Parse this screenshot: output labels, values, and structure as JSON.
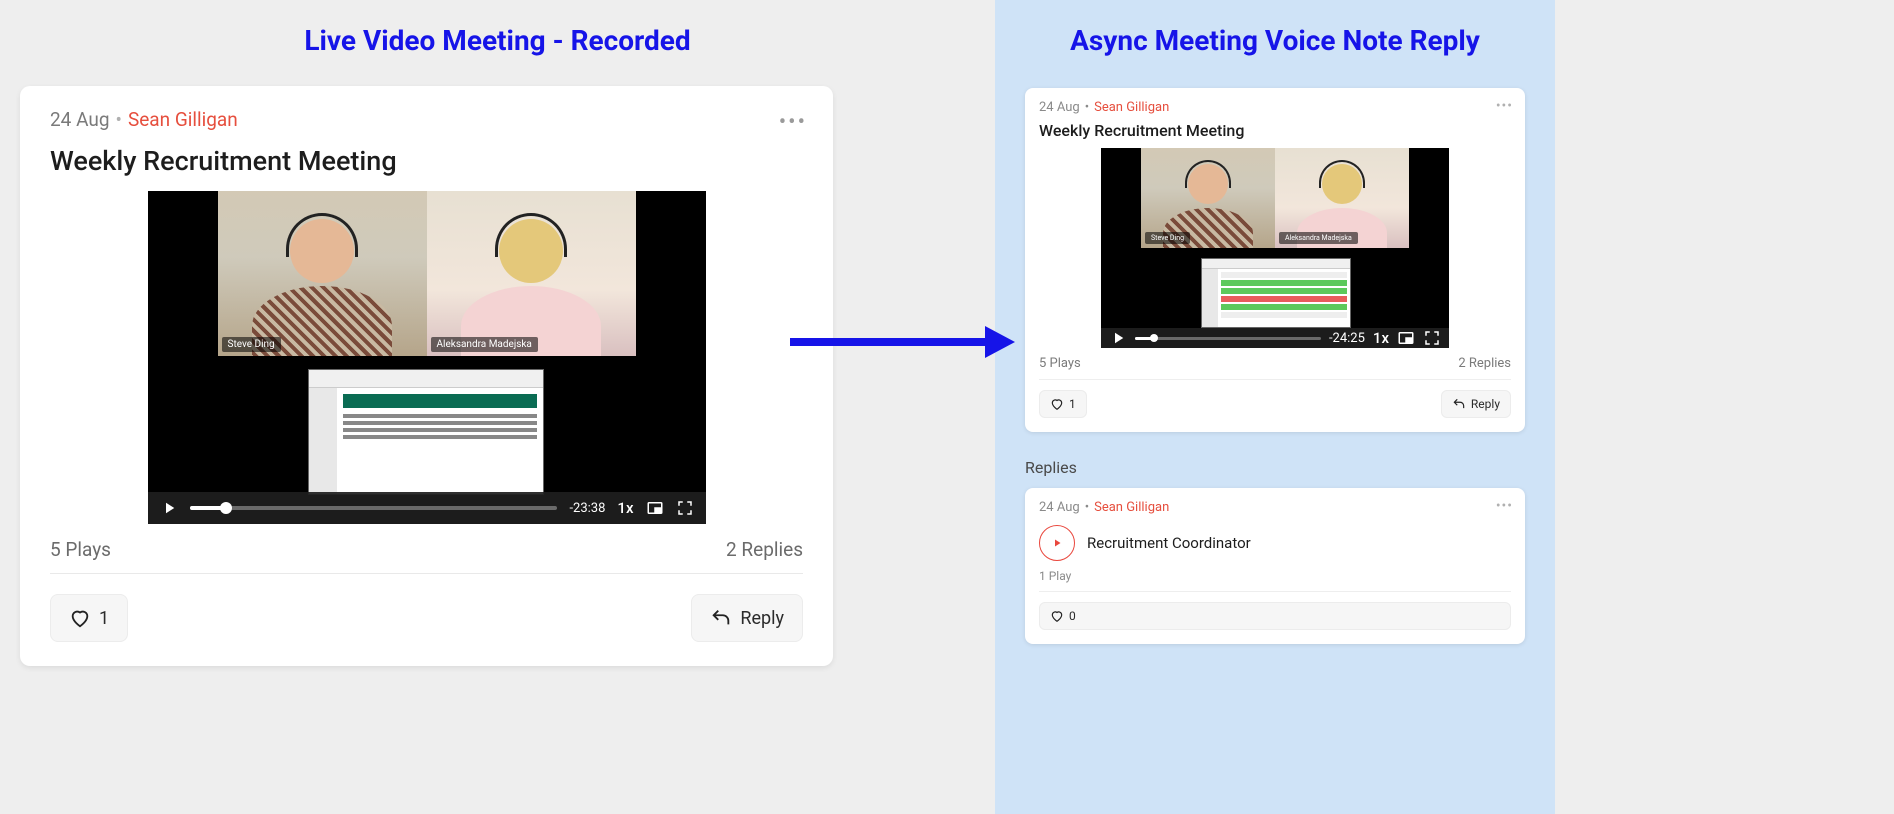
{
  "headings": {
    "left": "Live Video Meeting - Recorded",
    "right": "Async Meeting Voice Note Reply"
  },
  "left_post": {
    "date": "24 Aug",
    "author": "Sean Gilligan",
    "title": "Weekly Recruitment Meeting",
    "video": {
      "participants": [
        "Steve Ding",
        "Aleksandra Madejska"
      ],
      "time_remaining": "-23:38",
      "speed": "1x"
    },
    "plays": "5 Plays",
    "replies": "2 Replies",
    "like_count": "1",
    "reply_label": "Reply"
  },
  "right_post": {
    "date": "24 Aug",
    "author": "Sean Gilligan",
    "title": "Weekly Recruitment Meeting",
    "video": {
      "participants": [
        "Steve Ding",
        "Aleksandra Madejska"
      ],
      "time_remaining": "-24:25",
      "speed": "1x"
    },
    "plays": "5 Plays",
    "replies": "2 Replies",
    "like_count": "1",
    "reply_label": "Reply"
  },
  "replies_section": {
    "label": "Replies",
    "item": {
      "date": "24 Aug",
      "author": "Sean Gilligan",
      "title": "Recruitment Coordinator",
      "plays": "1 Play",
      "like_count": "0"
    }
  }
}
